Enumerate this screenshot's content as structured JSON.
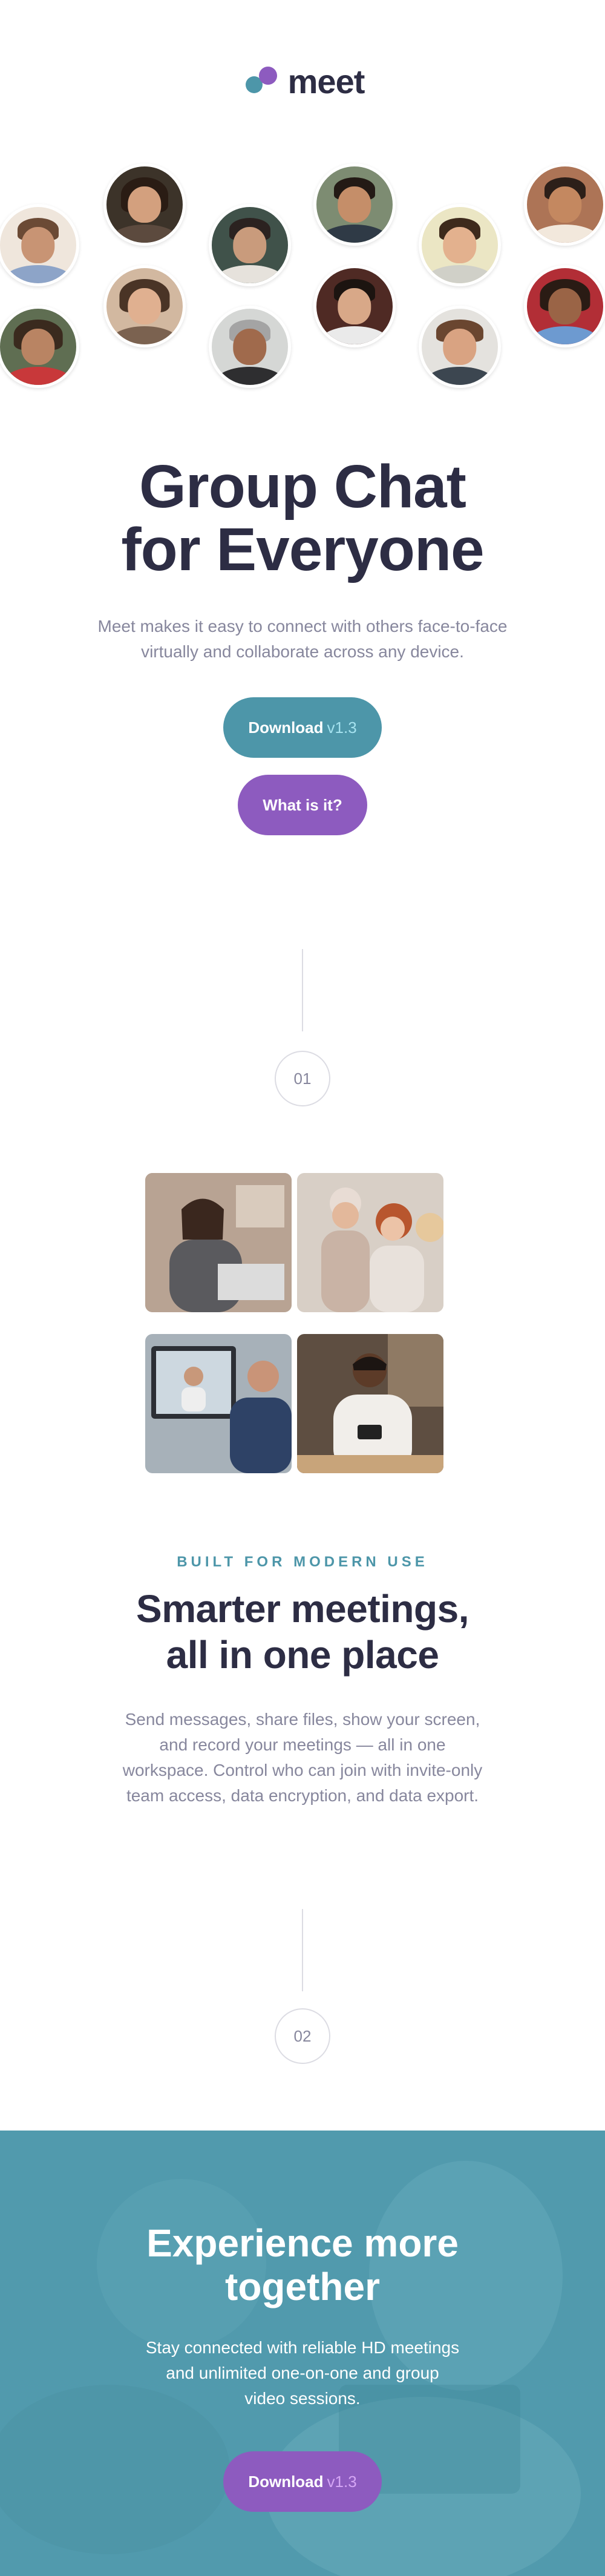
{
  "brand": {
    "name": "meet",
    "colors": {
      "teal": "#4d96a9",
      "purple": "#8d5bbf",
      "dark": "#2d2d44",
      "muted": "#87879d"
    }
  },
  "hero": {
    "title_line1": "Group Chat",
    "title_line2": "for Everyone",
    "subtitle": "Meet makes it easy to connect with others face-to-face virtually and collaborate across any device.",
    "download_label": "Download",
    "download_version": "v1.3",
    "what_label": "What is it?"
  },
  "steps": {
    "first": "01",
    "second": "02"
  },
  "features": {
    "eyebrow": "BUILT FOR MODERN USE",
    "title_line1": "Smarter meetings,",
    "title_line2": "all in one place",
    "text": "Send messages, share files, show your screen, and record your meetings — all in one workspace. Control who can join with invite-only team access, data encryption, and data export."
  },
  "cta": {
    "title_line1": "Experience more",
    "title_line2": "together",
    "text": "Stay connected with reliable HD meetings and unlimited one-on-one and group video sessions.",
    "download_label": "Download",
    "download_version": "v1.3"
  }
}
